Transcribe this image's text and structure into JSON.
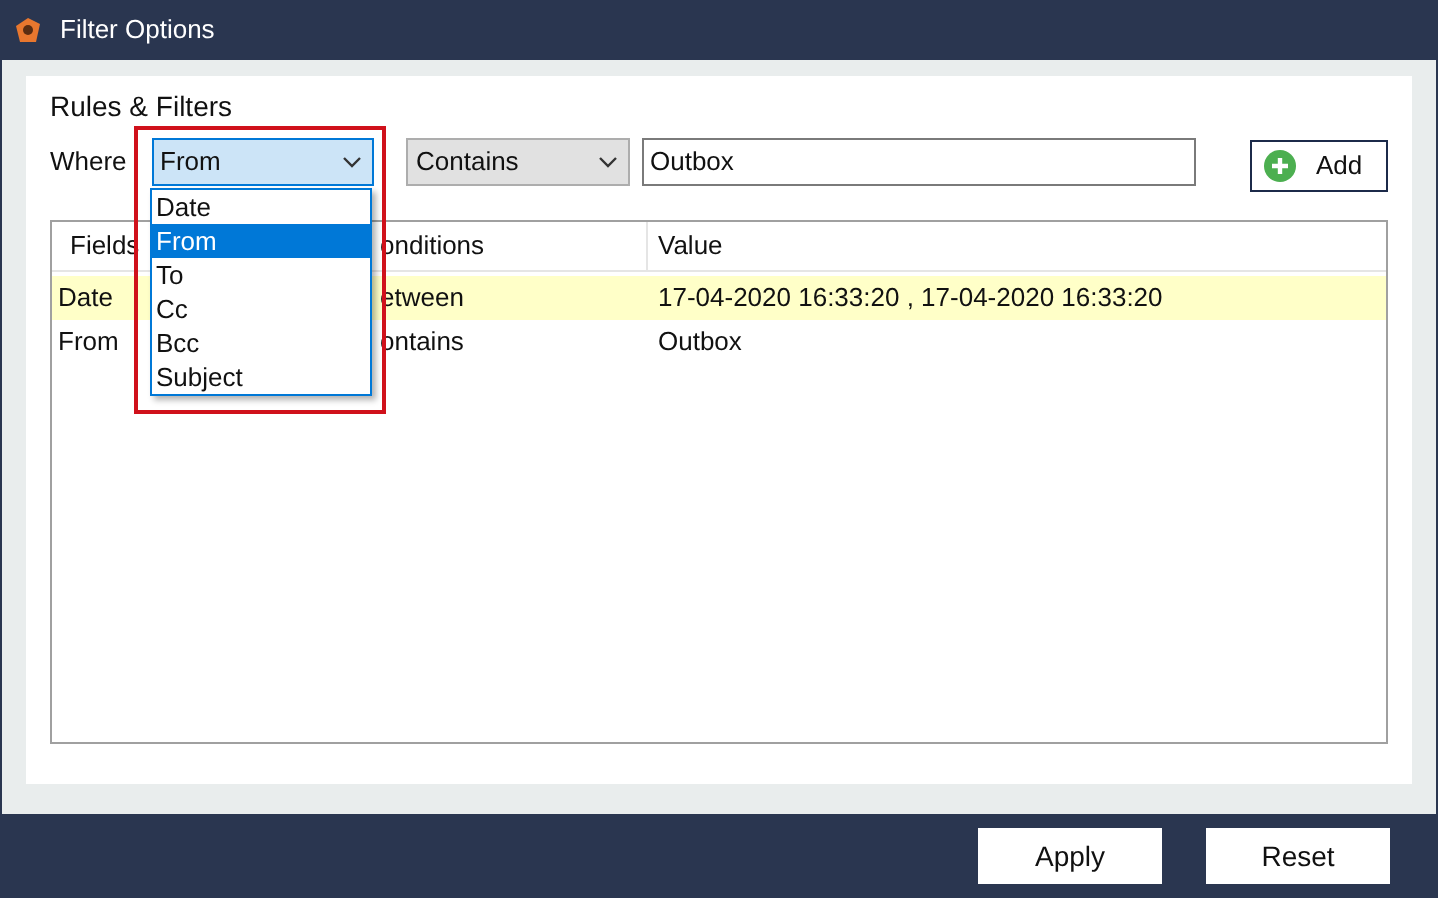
{
  "window": {
    "title": "Filter Options"
  },
  "section_title": "Rules & Filters",
  "where_label": "Where",
  "field_combo": {
    "value": "From",
    "expanded": true,
    "options": [
      {
        "label": "Date",
        "selected": false
      },
      {
        "label": "From",
        "selected": true
      },
      {
        "label": "To",
        "selected": false
      },
      {
        "label": "Cc",
        "selected": false
      },
      {
        "label": "Bcc",
        "selected": false
      },
      {
        "label": "Subject",
        "selected": false
      }
    ]
  },
  "condition_combo": {
    "value": "Contains"
  },
  "value_field": {
    "value": "Outbox"
  },
  "add_button": "Add",
  "table": {
    "columns": [
      "Fields",
      "onditions",
      "Value"
    ],
    "rows": [
      {
        "cells": [
          "Date",
          "etween",
          "17-04-2020 16:33:20 , 17-04-2020 16:33:20"
        ],
        "selected": true
      },
      {
        "cells": [
          "From",
          "ontains",
          "Outbox"
        ],
        "selected": false
      }
    ]
  },
  "buttons": [
    "Apply",
    "Reset"
  ]
}
